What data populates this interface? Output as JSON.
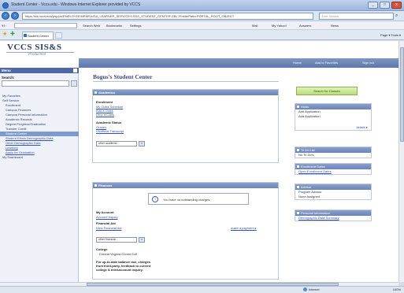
{
  "browser": {
    "window_title": "Student Center - Vccs.edu - Windows Internet Explorer provided by VCCS",
    "address": "https://sis.vccs.edu/psp/ps/EMPLOYEE/HRMS/c/SA_LEARNER_SERVICES.SSS_STUDENT_CENTER.GBL?FolderPath=PORTAL_ROOT_OBJECT",
    "search_placeholder": "Live Search",
    "toolbar_left": "Y! ·",
    "toolbar_items": [
      "Search Web",
      "Bookmarks",
      "Settings",
      "Mail",
      "My Yahoo!",
      "Answers",
      "News"
    ],
    "tab_label": "Student Center",
    "command_bar": "Page ▾  Tools ▾",
    "status_zone": "Internet",
    "status_zoom": "100%",
    "window_buttons": {
      "minimize": "_",
      "maximize": "□",
      "close": "x"
    }
  },
  "site": {
    "logo": "VCCS SIS&S",
    "logo_sub": "Production",
    "topnav": [
      "Home",
      "Add to Favorites",
      "Sign out"
    ]
  },
  "leftnav": {
    "menu_title": "Menu",
    "search_label": "Search:",
    "items": [
      {
        "label": "My Favorites",
        "style": "plain"
      },
      {
        "label": "Self Service",
        "style": "plain"
      },
      {
        "label": "Enrollment",
        "style": "indent"
      },
      {
        "label": "Campus Finances",
        "style": "indent"
      },
      {
        "label": "Campus Personal Information",
        "style": "indent"
      },
      {
        "label": "Academic Records",
        "style": "indent"
      },
      {
        "label": "Degree Progress/Graduation",
        "style": "indent"
      },
      {
        "label": "Transfer Credit",
        "style": "indent"
      },
      {
        "label": "Student Center",
        "style": "sel"
      },
      {
        "label": "Student Ethnic Demographic Data",
        "style": "link"
      },
      {
        "label": "Other Demographic Data",
        "style": "link"
      },
      {
        "label": "Learning",
        "style": "link"
      },
      {
        "label": "Apply for Graduation",
        "style": "link"
      },
      {
        "label": "My Dashboard",
        "style": "plain"
      }
    ]
  },
  "main": {
    "title": "Bogus's Student Center",
    "academics": {
      "header": "Academics",
      "enrollment_label": "Enrollment",
      "links": [
        "My Class Schedule",
        "Add a Class",
        "Drop a Class"
      ],
      "status_label": "Academic Status",
      "status_links": [
        "Grades",
        "Unofficial Transcript"
      ],
      "select_value": "other academic...",
      "go_label": "»",
      "holds_icon": "i",
      "holds_text": "You have no outstanding charges."
    },
    "finances": {
      "header": "Finances",
      "account_label": "My Account",
      "account_link": "Account Inquiry",
      "aid_label": "Financial Aid",
      "aid_link": "View Financial Aid",
      "select_value": "other financial...",
      "go_label": "»",
      "college_label": "College",
      "college_value": "Central Virginia Comm Coll",
      "bold_note": "For up-to-date balance due, charges from third-party, feedback to current college & third-account inquiry.",
      "right_note": "make a payment ▸"
    }
  },
  "side": {
    "enroll_button": "Search for Classes",
    "boxes": [
      {
        "header": "Holds",
        "rows": [
          "Add Application",
          "Add Application"
        ],
        "more": "details ▸"
      },
      {
        "header": "To Do List",
        "rows": [
          "No To Do's."
        ]
      },
      {
        "header": "Enrollment Dates",
        "rows": [
          "Open Enrollment Dates"
        ],
        "link": true
      },
      {
        "header": "Advisor",
        "rows": [
          "Program Advisor",
          "None Assigned"
        ]
      },
      {
        "header": "Personal Information",
        "rows": [
          "Demographic Data Summary"
        ],
        "link": true
      }
    ]
  }
}
